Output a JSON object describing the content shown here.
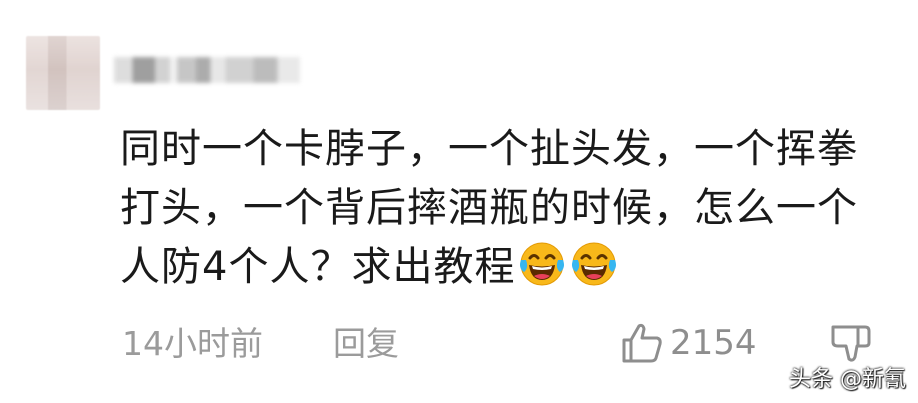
{
  "comment": {
    "text": "同时一个卡脖子，一个扯头发，一个挥拳打头，一个背后摔酒瓶的时候，怎么一个人防4个人？求出教程"
  },
  "emojis": [
    "laugh-cry-icon",
    "laugh-cry-icon"
  ],
  "meta": {
    "time": "14小时前",
    "reply_label": "回复",
    "like_count": "2154"
  },
  "watermark": "头条 @新氰",
  "colors": {
    "text": "#1a1a1a",
    "meta": "#9b9b9b",
    "emoji_face": "#f8b81a"
  }
}
